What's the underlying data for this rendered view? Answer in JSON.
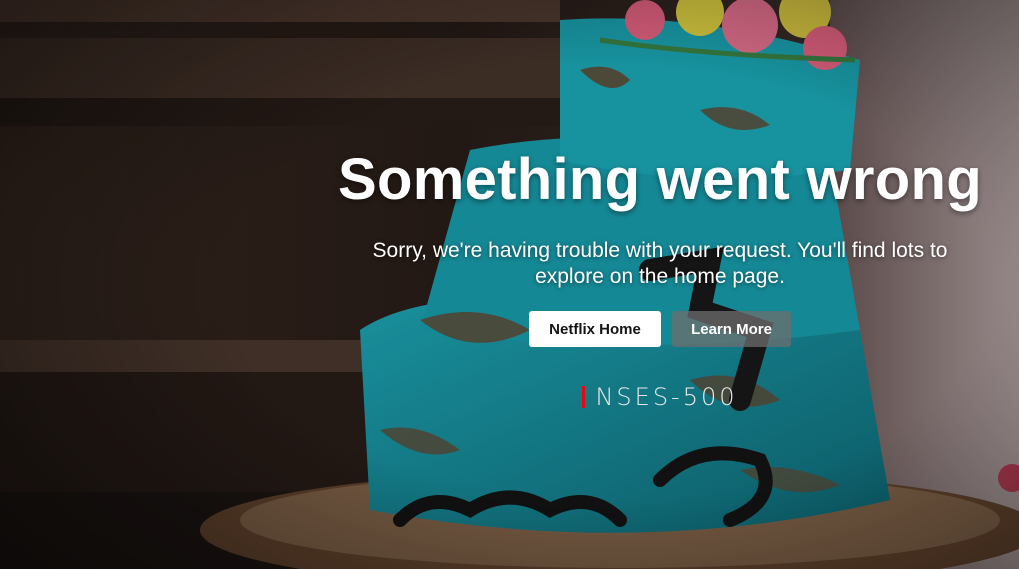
{
  "error_page": {
    "title": "Something went wrong",
    "message": "Sorry, we're having trouble with your request. You'll find lots to explore on the home page.",
    "primary_button": "Netflix Home",
    "secondary_button": "Learn More",
    "error_code": "NSES-500"
  },
  "colors": {
    "accent": "#e50914",
    "frosting": "#1aa0b0",
    "background": "#2a1f1a"
  }
}
